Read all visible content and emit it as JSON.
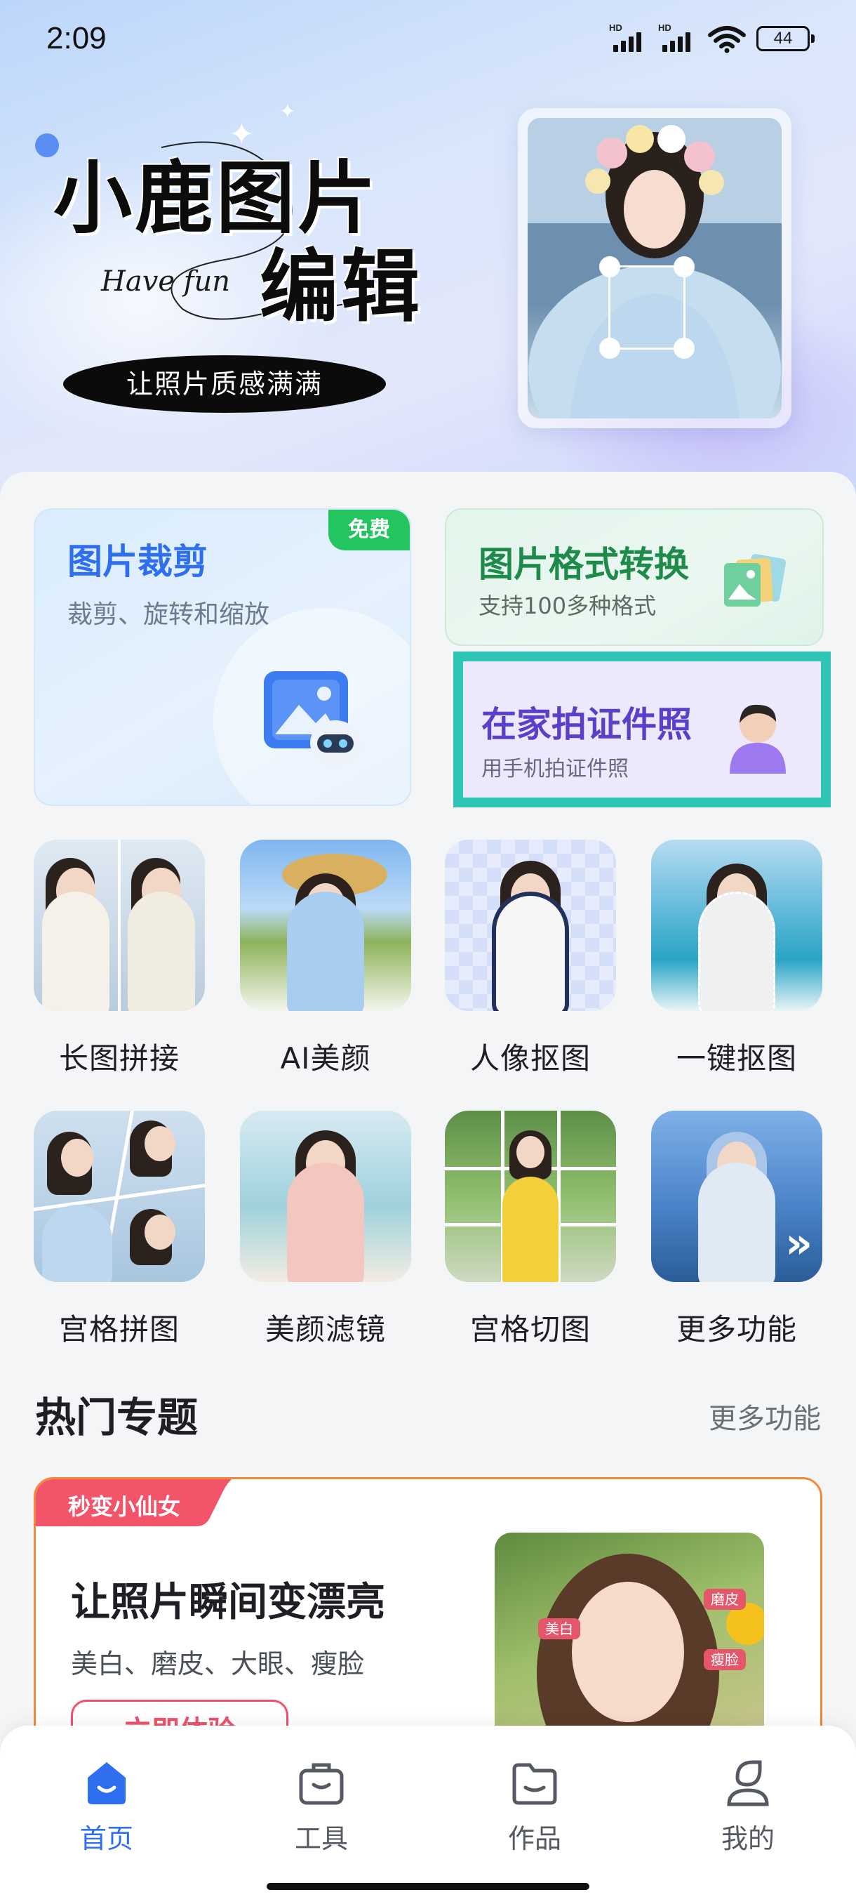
{
  "status_bar": {
    "time": "2:09",
    "sim1_label": "HD",
    "sim2_label": "HD",
    "battery": "44"
  },
  "hero": {
    "title_line1": "小鹿图片",
    "title_line2": "编辑",
    "script": "Have fun",
    "slogan": "让照片质感满满"
  },
  "cards": {
    "crop": {
      "title": "图片裁剪",
      "subtitle": "裁剪、旋转和缩放",
      "badge": "免费"
    },
    "convert": {
      "title": "图片格式转换",
      "subtitle": "支持100多种格式"
    },
    "id_photo": {
      "title": "在家拍证件照",
      "subtitle": "用手机拍证件照"
    }
  },
  "tools": [
    {
      "label": "长图拼接"
    },
    {
      "label": "AI美颜"
    },
    {
      "label": "人像抠图"
    },
    {
      "label": "一键抠图"
    },
    {
      "label": "宫格拼图"
    },
    {
      "label": "美颜滤镜"
    },
    {
      "label": "宫格切图"
    },
    {
      "label": "更多功能"
    }
  ],
  "hot_topics": {
    "title": "热门专题",
    "more": "更多功能",
    "promo": {
      "tag": "秒变小仙女",
      "title": "让照片瞬间变漂亮",
      "subtitle": "美白、磨皮、大眼、瘦脸",
      "button": "立即体验",
      "labels": [
        "美白",
        "磨皮",
        "瘦脸"
      ]
    }
  },
  "bottom_nav": {
    "items": [
      {
        "label": "首页",
        "icon": "home-icon",
        "active": true
      },
      {
        "label": "工具",
        "icon": "toolbox-icon",
        "active": false
      },
      {
        "label": "作品",
        "icon": "folder-icon",
        "active": false
      },
      {
        "label": "我的",
        "icon": "profile-icon",
        "active": false
      }
    ]
  },
  "colors": {
    "accent_blue": "#2e6ff0",
    "free_badge": "#22c55e",
    "convert_green": "#1e8b4a",
    "id_purple": "#5b3fc8",
    "highlight_teal": "#2ec5b4",
    "promo_red": "#f0526b"
  }
}
